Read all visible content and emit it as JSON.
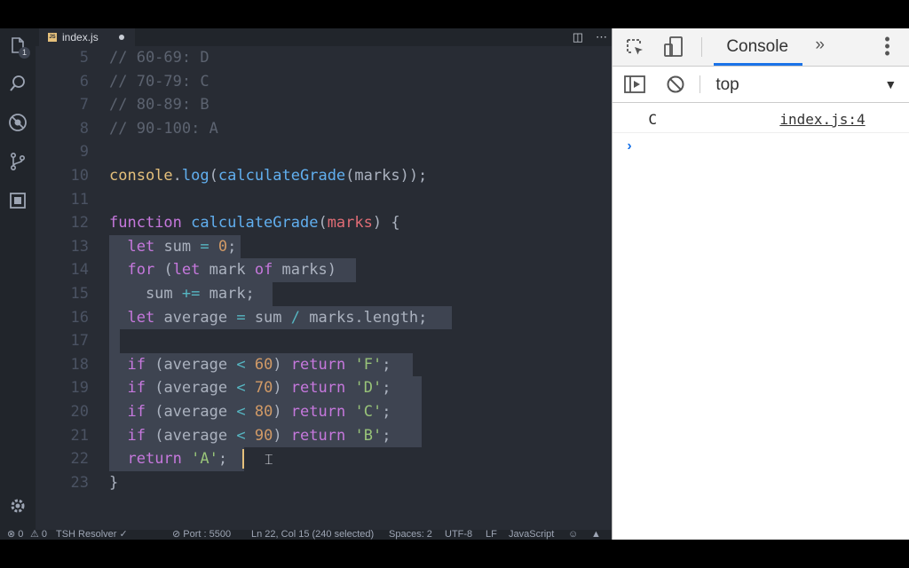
{
  "editor": {
    "tab": {
      "filename": "index.js",
      "icon": "js-file-icon"
    },
    "lines": [
      {
        "n": "5",
        "tokens": [
          [
            "c-com",
            "// 60-69: D"
          ]
        ]
      },
      {
        "n": "6",
        "tokens": [
          [
            "c-com",
            "// 70-79: C"
          ]
        ]
      },
      {
        "n": "7",
        "tokens": [
          [
            "c-com",
            "// 80-89: B"
          ]
        ]
      },
      {
        "n": "8",
        "tokens": [
          [
            "c-com",
            "// 90-100: A"
          ]
        ]
      },
      {
        "n": "9",
        "tokens": []
      },
      {
        "n": "10",
        "tokens": [
          [
            "c-fn2",
            "console"
          ],
          [
            "",
            "."
          ],
          [
            "c-fn",
            "log"
          ],
          [
            "",
            "("
          ],
          [
            "c-fn",
            "calculateGrade"
          ],
          [
            "",
            "(marks));"
          ]
        ]
      },
      {
        "n": "11",
        "tokens": []
      },
      {
        "n": "12",
        "tokens": [
          [
            "c-kw",
            "function"
          ],
          [
            "",
            " "
          ],
          [
            "c-fn",
            "calculateGrade"
          ],
          [
            "",
            "("
          ],
          [
            "c-prm",
            "marks"
          ],
          [
            "",
            ") {"
          ]
        ]
      },
      {
        "n": "13",
        "tokens": [
          [
            "",
            "  "
          ],
          [
            "c-kw",
            "let"
          ],
          [
            "",
            " sum "
          ],
          [
            "c-op",
            "="
          ],
          [
            "",
            " "
          ],
          [
            "c-num",
            "0"
          ],
          [
            "",
            ";"
          ]
        ]
      },
      {
        "n": "14",
        "tokens": [
          [
            "",
            "  "
          ],
          [
            "c-kw",
            "for"
          ],
          [
            "",
            " ("
          ],
          [
            "c-kw",
            "let"
          ],
          [
            "",
            " mark "
          ],
          [
            "c-kw",
            "of"
          ],
          [
            "",
            " marks)"
          ]
        ]
      },
      {
        "n": "15",
        "tokens": [
          [
            "",
            "    sum "
          ],
          [
            "c-op",
            "+="
          ],
          [
            "",
            " mark;"
          ]
        ]
      },
      {
        "n": "16",
        "tokens": [
          [
            "",
            "  "
          ],
          [
            "c-kw",
            "let"
          ],
          [
            "",
            " average "
          ],
          [
            "c-op",
            "="
          ],
          [
            "",
            " sum "
          ],
          [
            "c-op",
            "/"
          ],
          [
            "",
            " marks.length;"
          ]
        ]
      },
      {
        "n": "17",
        "tokens": []
      },
      {
        "n": "18",
        "tokens": [
          [
            "",
            "  "
          ],
          [
            "c-kw",
            "if"
          ],
          [
            "",
            " (average "
          ],
          [
            "c-op",
            "<"
          ],
          [
            "",
            " "
          ],
          [
            "c-num",
            "60"
          ],
          [
            "",
            ") "
          ],
          [
            "c-kw",
            "return"
          ],
          [
            "",
            " "
          ],
          [
            "c-str",
            "'F'"
          ],
          [
            "",
            ";"
          ]
        ]
      },
      {
        "n": "19",
        "tokens": [
          [
            "",
            "  "
          ],
          [
            "c-kw",
            "if"
          ],
          [
            "",
            " (average "
          ],
          [
            "c-op",
            "<"
          ],
          [
            "",
            " "
          ],
          [
            "c-num",
            "70"
          ],
          [
            "",
            ") "
          ],
          [
            "c-kw",
            "return"
          ],
          [
            "",
            " "
          ],
          [
            "c-str",
            "'D'"
          ],
          [
            "",
            ";"
          ]
        ]
      },
      {
        "n": "20",
        "tokens": [
          [
            "",
            "  "
          ],
          [
            "c-kw",
            "if"
          ],
          [
            "",
            " (average "
          ],
          [
            "c-op",
            "<"
          ],
          [
            "",
            " "
          ],
          [
            "c-num",
            "80"
          ],
          [
            "",
            ") "
          ],
          [
            "c-kw",
            "return"
          ],
          [
            "",
            " "
          ],
          [
            "c-str",
            "'C'"
          ],
          [
            "",
            ";"
          ]
        ]
      },
      {
        "n": "21",
        "tokens": [
          [
            "",
            "  "
          ],
          [
            "c-kw",
            "if"
          ],
          [
            "",
            " (average "
          ],
          [
            "c-op",
            "<"
          ],
          [
            "",
            " "
          ],
          [
            "c-num",
            "90"
          ],
          [
            "",
            ") "
          ],
          [
            "c-kw",
            "return"
          ],
          [
            "",
            " "
          ],
          [
            "c-str",
            "'B'"
          ],
          [
            "",
            ";"
          ]
        ]
      },
      {
        "n": "22",
        "tokens": [
          [
            "",
            "  "
          ],
          [
            "c-kw",
            "return"
          ],
          [
            "",
            " "
          ],
          [
            "c-str",
            "'A'"
          ],
          [
            "",
            ";"
          ]
        ]
      },
      {
        "n": "23",
        "tokens": [
          [
            "",
            "}"
          ]
        ]
      }
    ]
  },
  "statusbar": {
    "errors": "⊗ 0",
    "warnings": "⚠ 0",
    "resolver": "TSH Resolver ✓",
    "port": "⊘ Port : 5500",
    "position": "Ln 22, Col 15 (240 selected)",
    "spaces": "Spaces: 2",
    "encoding": "UTF-8",
    "eol": "LF",
    "language": "JavaScript"
  },
  "activitybar": {
    "explorer_badge": "1",
    "icons": [
      "files-icon",
      "search-icon",
      "debug-icon",
      "source-control-icon",
      "extensions-icon",
      "gear-icon"
    ]
  },
  "devtools": {
    "tab_console": "Console",
    "more_tabs": "»",
    "context": "top",
    "log": {
      "message": "C",
      "source": "index.js:4"
    },
    "prompt": "›"
  },
  "colors": {
    "editor_bg": "#282c34",
    "keyword": "#c678dd",
    "function": "#61afef",
    "string": "#98c379",
    "number": "#d19a66",
    "accent": "#1a73e8"
  }
}
